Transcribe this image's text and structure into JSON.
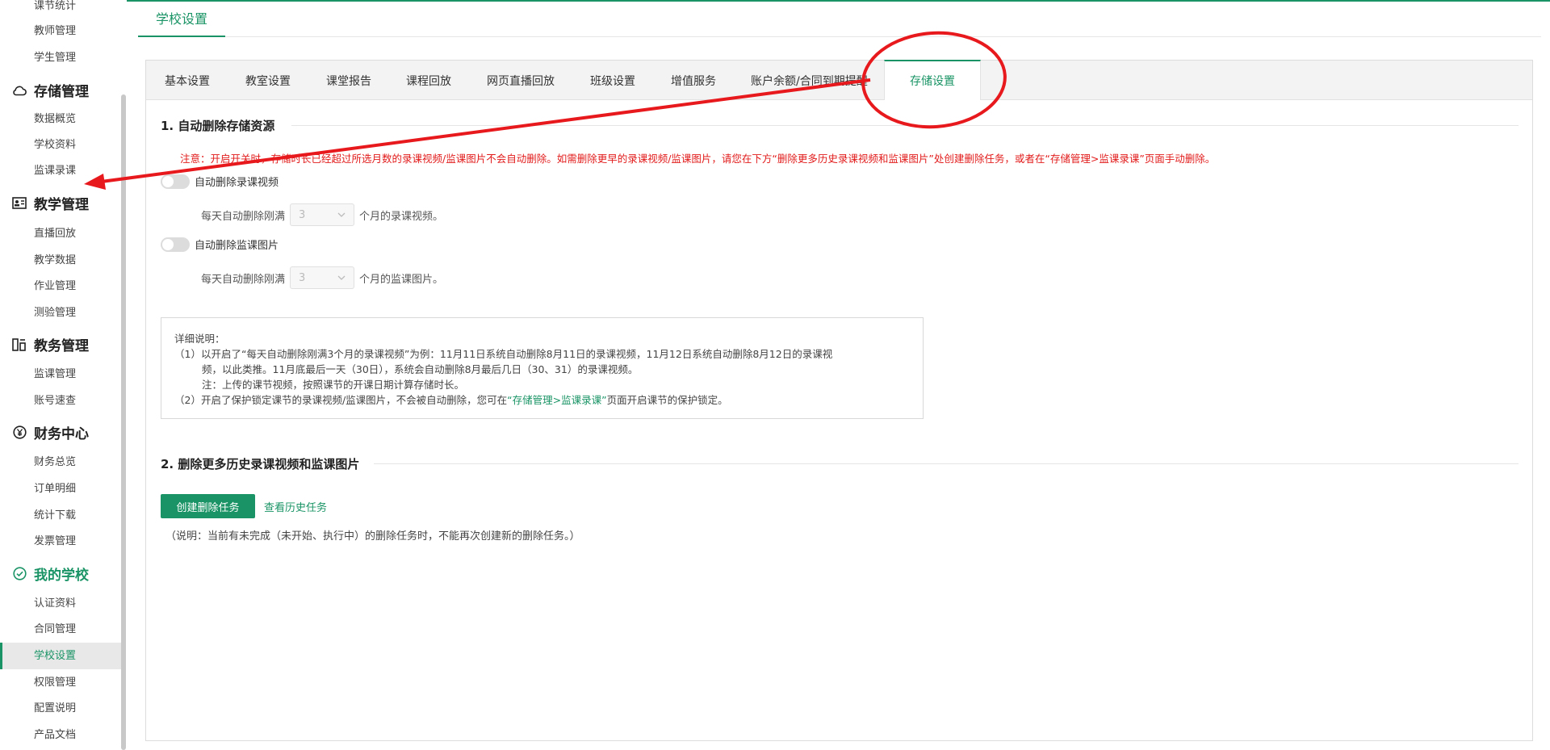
{
  "sidebar": {
    "items_top": [
      "课节统计",
      "教师管理",
      "学生管理"
    ],
    "groups": [
      {
        "title": "存储管理",
        "icon": "cloud-icon",
        "items": [
          "数据概览",
          "学校资料",
          "监课录课"
        ]
      },
      {
        "title": "教学管理",
        "icon": "teaching-icon",
        "items": [
          "直播回放",
          "教学数据",
          "作业管理",
          "测验管理"
        ]
      },
      {
        "title": "教务管理",
        "icon": "academic-icon",
        "items": [
          "监课管理",
          "账号速查"
        ]
      },
      {
        "title": "财务中心",
        "icon": "yen-icon",
        "items": [
          "财务总览",
          "订单明细",
          "统计下载",
          "发票管理"
        ]
      },
      {
        "title": "我的学校",
        "icon": "school-check-icon",
        "items": [
          "认证资料",
          "合同管理",
          "学校设置",
          "权限管理",
          "配置说明",
          "产品文档"
        ]
      }
    ],
    "active_item": "学校设置"
  },
  "page": {
    "title": "学校设置"
  },
  "tabs": [
    "基本设置",
    "教室设置",
    "课堂报告",
    "课程回放",
    "网页直播回放",
    "班级设置",
    "增值服务",
    "账户余额/合同到期提醒",
    "存储设置"
  ],
  "active_tab": "存储设置",
  "section1": {
    "title": "1. 自动删除存储资源",
    "notice": "注意：开启开关时，存储时长已经超过所选月数的录课视频/监课图片不会自动删除。如需删除更早的录课视频/监课图片，请您在下方“删除更多历史录课视频和监课图片”处创建删除任务，或者在“存储管理>监课录课”页面手动删除。",
    "toggle_video_label": "自动删除录课视频",
    "video_prefix": "每天自动删除刚满",
    "video_value": "3",
    "video_suffix": "个月的录课视频。",
    "toggle_image_label": "自动删除监课图片",
    "image_prefix": "每天自动删除刚满",
    "image_value": "3",
    "image_suffix": "个月的监课图片。",
    "desc": {
      "heading": "详细说明：",
      "line1": "（1）以开启了“每天自动删除刚满3个月的录课视频”为例：11月11日系统自动删除8月11日的录课视频，11月12日系统自动删除8月12日的录课视",
      "line1b": "频，以此类推。11月底最后一天（30日），系统会自动删除8月最后几日（30、31）的录课视频。",
      "line1c": "注：上传的课节视频，按照课节的开课日期计算存储时长。",
      "line2_prefix": "（2）开启了保护锁定课节的录课视频/监课图片，不会被自动删除，您可在",
      "line2_link": "“存储管理>监课录课”",
      "line2_suffix": "页面开启课节的保护锁定。"
    }
  },
  "section2": {
    "title": "2. 删除更多历史录课视频和监课图片",
    "create_button": "创建删除任务",
    "history_link": "查看历史任务",
    "note": "（说明：当前有未完成（未开始、执行中）的删除任务时，不能再次创建新的删除任务。）"
  },
  "colors": {
    "brand": "#1a9466",
    "warning": "#e21b1b",
    "annotation": "#e8191d"
  }
}
